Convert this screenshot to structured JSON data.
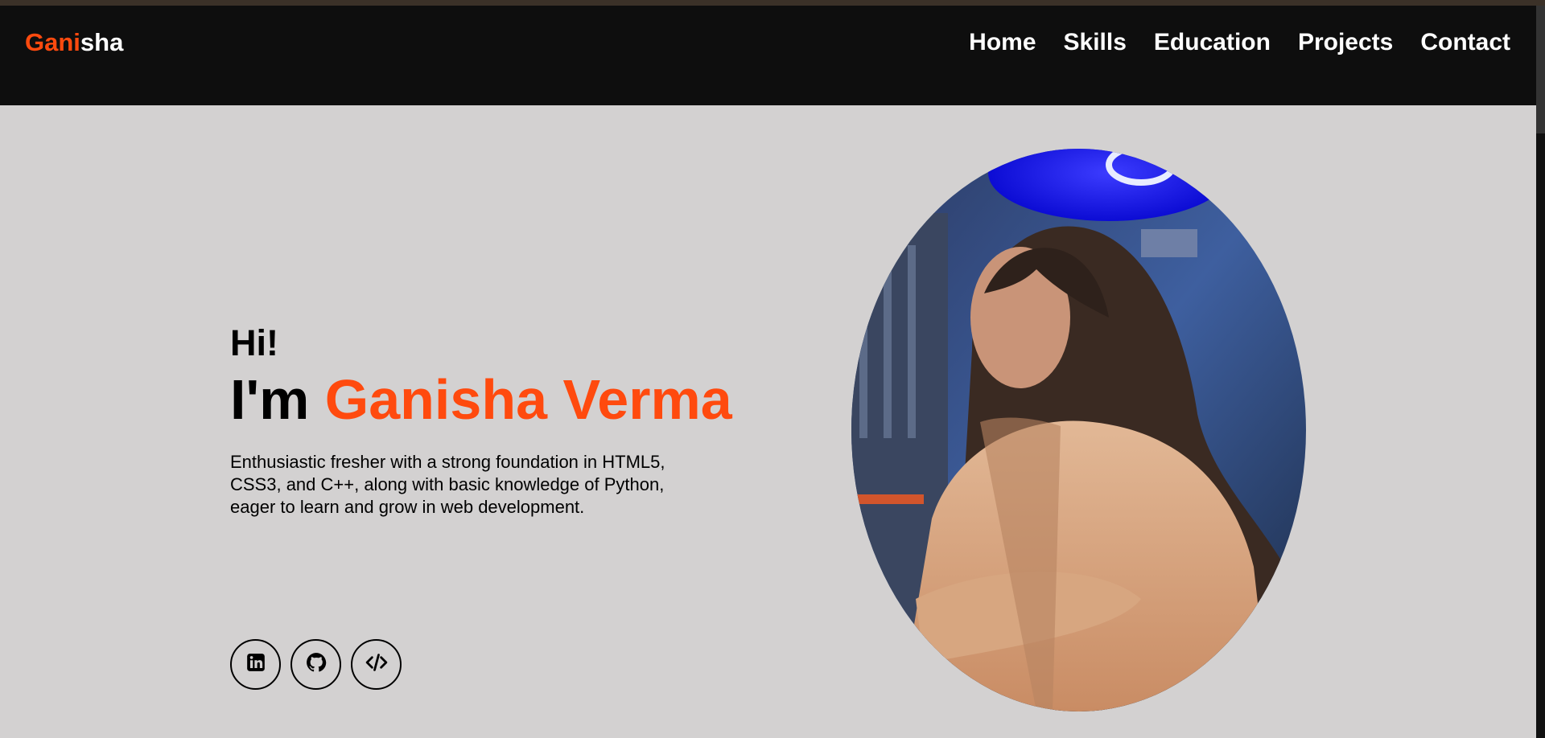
{
  "logo": {
    "accent": "Gani",
    "rest": "sha"
  },
  "nav": {
    "home": "Home",
    "skills": "Skills",
    "education": "Education",
    "projects": "Projects",
    "contact": "Contact"
  },
  "hero": {
    "greeting": "Hi!",
    "intro_prefix": "I'm",
    "name": "Ganisha Verma",
    "description": "Enthusiastic fresher with a strong foundation in HTML5, CSS3, and C++, along with basic knowledge of Python, eager to learn and grow in web development."
  },
  "social": {
    "icons": [
      "linkedin-icon",
      "github-icon",
      "code-icon"
    ]
  },
  "colors": {
    "accent": "#ff4a0e",
    "navbar": "#0e0e0e",
    "background": "#d3d1d1"
  }
}
